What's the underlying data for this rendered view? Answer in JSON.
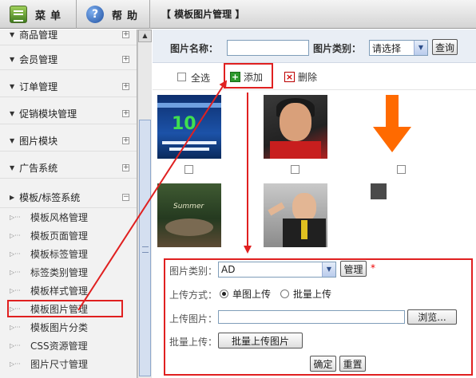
{
  "topbar": {
    "menu_label": "菜单",
    "help_label": "帮助",
    "page_title": "【 模板图片管理 】"
  },
  "sidebar": {
    "sections": [
      {
        "label": "商品管理"
      },
      {
        "label": "会员管理"
      },
      {
        "label": "订单管理"
      },
      {
        "label": "促销模块管理"
      },
      {
        "label": "图片模块"
      },
      {
        "label": "广告系统"
      },
      {
        "label": "模板/标签系统"
      }
    ],
    "subitems": [
      {
        "label": "模板风格管理"
      },
      {
        "label": "模板页面管理"
      },
      {
        "label": "模板标签管理"
      },
      {
        "label": "标签类别管理"
      },
      {
        "label": "模板样式管理"
      },
      {
        "label": "模板图片管理"
      },
      {
        "label": "模板图片分类"
      },
      {
        "label": "CSS资源管理"
      },
      {
        "label": "图片尺寸管理"
      }
    ]
  },
  "search": {
    "name_label": "图片名称：",
    "name_value": "",
    "category_label": "图片类别：",
    "category_value": "请选择",
    "query_label": "查询"
  },
  "actions": {
    "select_all": "全选",
    "add": "添加",
    "delete": "删除"
  },
  "thumbs": {
    "t1": {
      "number": "10"
    },
    "t4": {
      "caption": "Summer"
    }
  },
  "upload": {
    "category_label": "图片类别：",
    "category_value": "AD",
    "manage_label": "管理",
    "required_mark": "*",
    "mode_label": "上传方式：",
    "mode_single": "单图上传",
    "mode_batch": "批量上传",
    "file_label": "上传图片：",
    "file_value": "",
    "browse_label": "浏览...",
    "batch_label": "批量上传：",
    "batch_button": "批量上传图片",
    "ok_label": "确定",
    "reset_label": "重置"
  },
  "colors": {
    "highlight": "#e02020",
    "orange_arrow": "#ff6a00",
    "accent_blue": "#1c52a8"
  }
}
